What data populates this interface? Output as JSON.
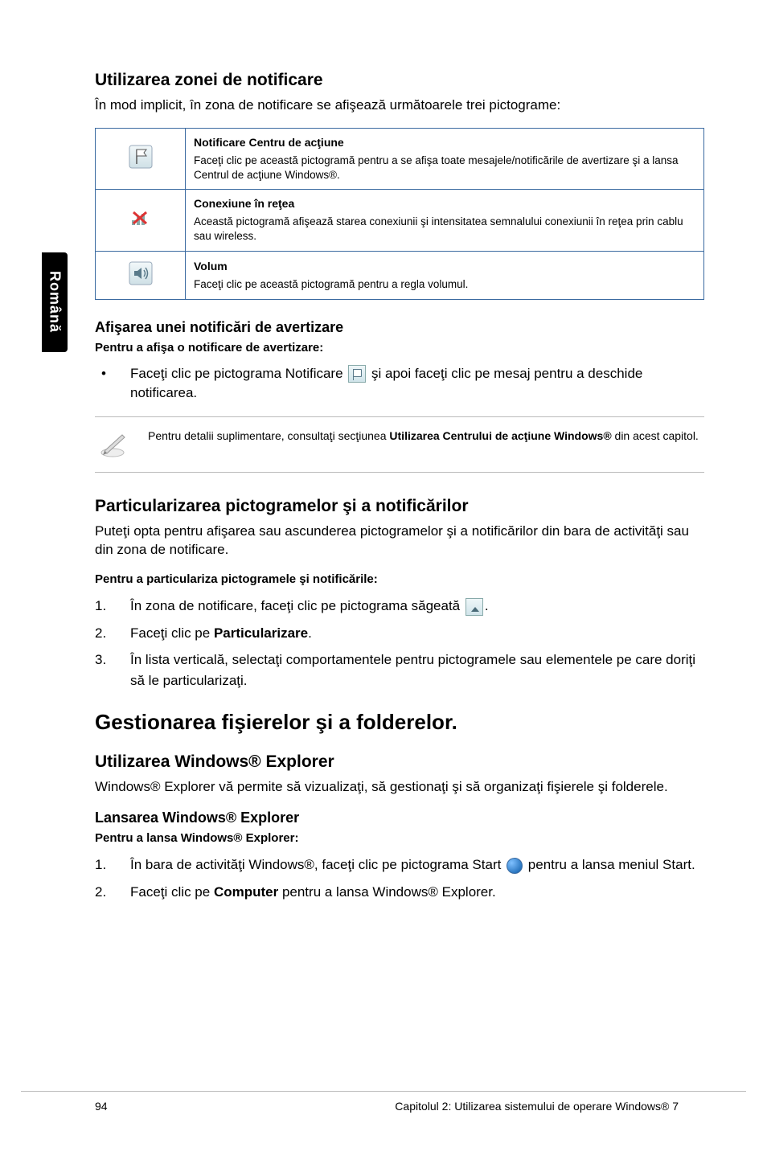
{
  "sidetab": "Română",
  "sec1": {
    "title": "Utilizarea zonei de notificare",
    "intro": "În mod implicit, în zona de notificare se afişează următoarele trei pictograme:"
  },
  "table": {
    "rows": [
      {
        "icon": "flag",
        "title": "Notificare Centru de acţiune",
        "desc": "Faceţi clic pe această pictogramă pentru a se afişa toate mesajele/notificările de avertizare şi a lansa Centrul de acţiune Windows®."
      },
      {
        "icon": "network",
        "title": "Conexiune în reţea",
        "desc": "Această pictogramă afişează starea conexiunii şi intensitatea semnalului conexiunii în reţea prin cablu sau wireless."
      },
      {
        "icon": "volume",
        "title": "Volum",
        "desc": "Faceţi clic pe această pictogramă pentru a regla volumul."
      }
    ]
  },
  "sec2": {
    "title": "Afişarea unei notificări de avertizare",
    "lead": "Pentru a afişa o notificare de avertizare:",
    "bullet_pre": "Faceţi clic pe pictograma Notificare ",
    "bullet_post": " şi apoi faceţi clic pe mesaj pentru a deschide notificarea."
  },
  "note": {
    "pre": "Pentru detalii suplimentare, consultaţi secţiunea ",
    "bold": "Utilizarea Centrului de acţiune Windows®",
    "post": " din acest capitol."
  },
  "sec3": {
    "title": "Particularizarea pictogramelor şi a notificărilor",
    "intro": "Puteţi opta pentru afişarea sau ascunderea pictogramelor şi a notificărilor din bara de activităţi sau din zona de notificare.",
    "lead": "Pentru a particulariza pictogramele şi notificările:",
    "steps": {
      "s1_pre": "În zona de notificare, faceţi clic pe pictograma săgeată ",
      "s1_post": ".",
      "s2_pre": "Faceţi clic pe ",
      "s2_bold": "Particularizare",
      "s2_post": ".",
      "s3": "În lista verticală, selectaţi comportamentele pentru pictogramele sau elementele pe care doriţi să le particularizaţi."
    }
  },
  "big": "Gestionarea fişierelor şi a folderelor.",
  "sec4": {
    "title": "Utilizarea Windows® Explorer",
    "intro": "Windows® Explorer vă permite să vizualizaţi, să gestionaţi şi să organizaţi fişierele şi folderele."
  },
  "sec5": {
    "title": "Lansarea Windows® Explorer",
    "lead": "Pentru a lansa Windows® Explorer:",
    "steps": {
      "s1_pre": "În bara de activităţi Windows®, faceţi clic pe pictograma Start ",
      "s1_post": " pentru a lansa meniul Start.",
      "s2_pre": "Faceţi clic pe ",
      "s2_bold": "Computer",
      "s2_post": " pentru a lansa Windows® Explorer."
    }
  },
  "footer": {
    "page": "94",
    "chapter": "Capitolul 2: Utilizarea sistemului de operare Windows® 7"
  }
}
